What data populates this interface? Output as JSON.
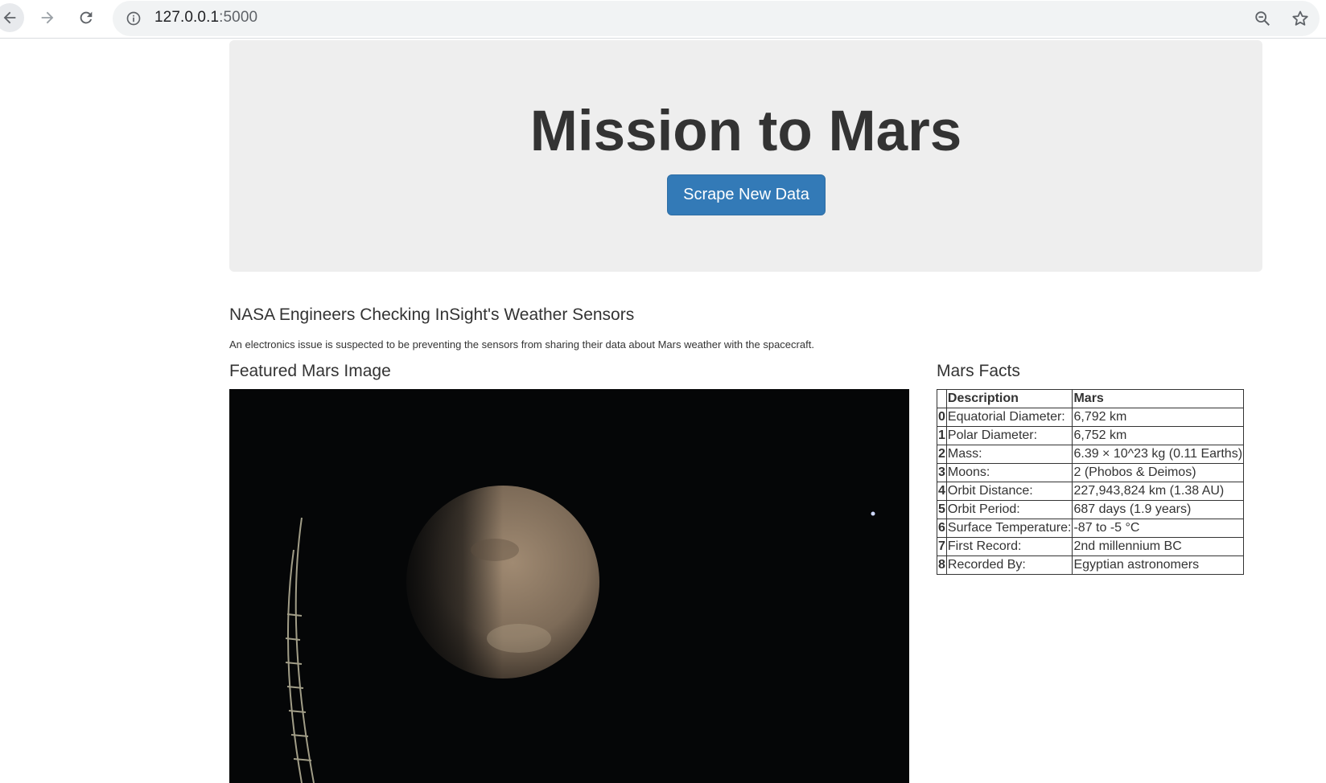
{
  "browser": {
    "url_host": "127.0.0.1",
    "url_port": ":5000"
  },
  "jumbotron": {
    "title": "Mission to Mars",
    "button_label": "Scrape New Data"
  },
  "news": {
    "title": "NASA Engineers Checking InSight's Weather Sensors",
    "teaser": "An electronics issue is suspected to be preventing the sensors from sharing their data about Mars weather with the spacecraft."
  },
  "featured": {
    "heading": "Featured Mars Image"
  },
  "facts": {
    "heading": "Mars Facts",
    "columns": [
      "Description",
      "Mars"
    ],
    "rows": [
      {
        "index": "0",
        "description": "Equatorial Diameter:",
        "value": "6,792 km"
      },
      {
        "index": "1",
        "description": "Polar Diameter:",
        "value": "6,752 km"
      },
      {
        "index": "2",
        "description": "Mass:",
        "value": "6.39 × 10^23 kg (0.11 Earths)"
      },
      {
        "index": "3",
        "description": "Moons:",
        "value": "2 (Phobos & Deimos)"
      },
      {
        "index": "4",
        "description": "Orbit Distance:",
        "value": "227,943,824 km (1.38 AU)"
      },
      {
        "index": "5",
        "description": "Orbit Period:",
        "value": "687 days (1.9 years)"
      },
      {
        "index": "6",
        "description": "Surface Temperature:",
        "value": "-87 to -5 °C"
      },
      {
        "index": "7",
        "description": "First Record:",
        "value": "2nd millennium BC"
      },
      {
        "index": "8",
        "description": "Recorded By:",
        "value": "Egyptian astronomers"
      }
    ]
  },
  "colors": {
    "button": "#337ab7",
    "jumbotron_bg": "#eeeeee"
  }
}
